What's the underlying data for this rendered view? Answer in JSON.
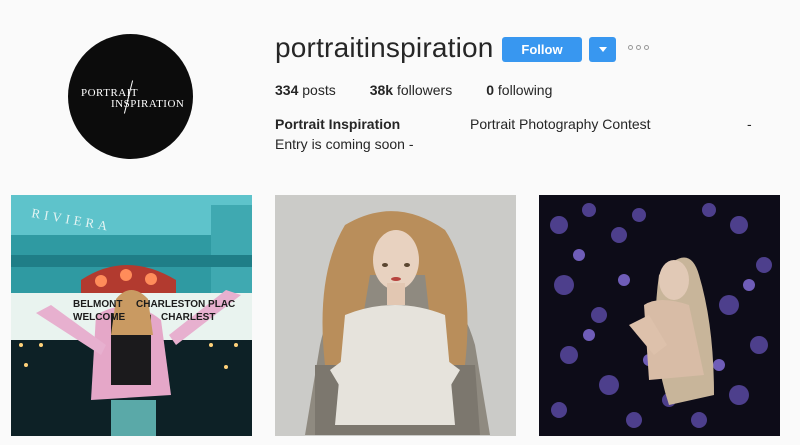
{
  "profile": {
    "avatar": {
      "line1": "PORTRAIT",
      "line2": "INSPIRATION"
    },
    "username": "portraitinspiration",
    "follow_label": "Follow",
    "stats": {
      "posts_count": "334",
      "posts_label": "posts",
      "followers_count": "38k",
      "followers_label": "followers",
      "following_count": "0",
      "following_label": "following"
    },
    "full_name": "Portrait Inspiration",
    "bio_line1": "Portrait Photography Contest",
    "bio_dash": "-",
    "bio_line2": "Entry is coming soon -"
  },
  "posts": [
    {
      "signs": {
        "riviera": "RIVIERA",
        "belmont": "BELMONT",
        "welcome": "WELCOME",
        "charleston": "CHARLESTON PLAC",
        "charleston2": "CHARLEST"
      }
    },
    {},
    {}
  ],
  "colors": {
    "accent": "#3897f0",
    "text": "#262626",
    "background": "#fafafa"
  }
}
